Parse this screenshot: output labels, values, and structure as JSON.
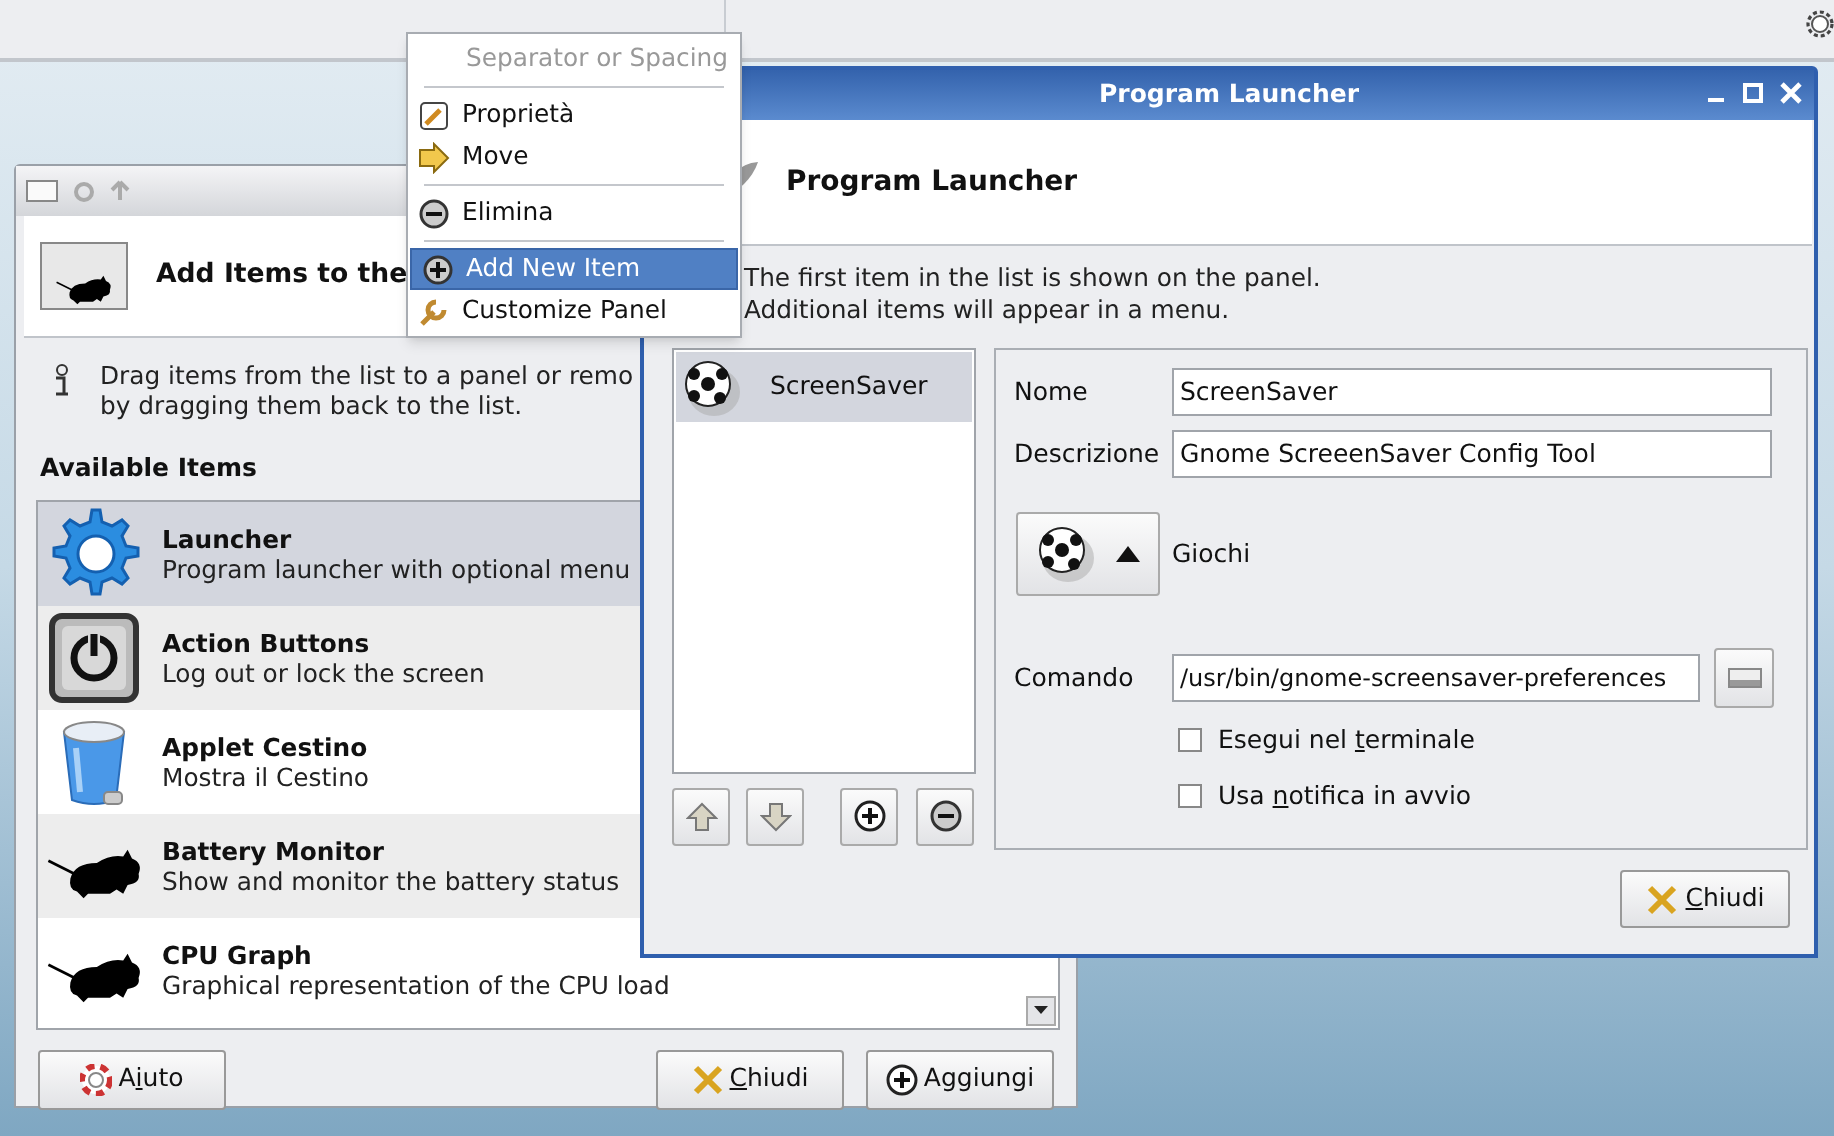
{
  "add_items_window": {
    "header": "Add Items to the",
    "info": [
      "Drag items from the list to a panel or remo",
      "by dragging them back to the list."
    ],
    "section_label": "Available Items",
    "items": [
      {
        "kind": "gear",
        "title": "Launcher",
        "description": "Program launcher with optional menu",
        "selected": true
      },
      {
        "kind": "power",
        "title": "Action Buttons",
        "description": "Log out or lock the screen",
        "selected": false
      },
      {
        "kind": "trash",
        "title": "Applet Cestino",
        "description": "Mostra il Cestino",
        "selected": false
      },
      {
        "kind": "mouse",
        "title": "Battery Monitor",
        "description": "Show and monitor the battery status",
        "selected": false
      },
      {
        "kind": "mouse",
        "title": "CPU Graph",
        "description": "Graphical representation of the CPU load",
        "selected": false
      }
    ],
    "buttons": [
      {
        "kind": "help",
        "before": "A",
        "key": "i",
        "after": "uto"
      },
      {
        "kind": "close",
        "key": "C",
        "after": "hiudi"
      },
      {
        "kind": "add",
        "before": "Aggiungi"
      }
    ]
  },
  "launcher_window": {
    "title": "Program Launcher",
    "header": "Program Launcher",
    "notes": [
      "The first item in the list is shown on the panel.",
      "Additional items will appear in a menu."
    ],
    "entries": [
      {
        "label": "ScreenSaver",
        "selected": true
      }
    ],
    "fields": [
      {
        "label": "Nome",
        "value": "ScreenSaver"
      },
      {
        "label": "Descrizione",
        "value": "Gnome ScreeenSaver Config Tool"
      }
    ],
    "category": "Giochi",
    "command": {
      "label": "Comando",
      "value": "/usr/bin/gnome-screensaver-preferences"
    },
    "options": [
      {
        "before": "Esegui nel ",
        "key": "t",
        "after": "erminale",
        "checked": false
      },
      {
        "before": "Usa ",
        "key": "n",
        "after": "otifica in avvio",
        "checked": false
      }
    ],
    "close_button": {
      "key": "C",
      "after": "hiudi"
    }
  },
  "context_menu": {
    "items": [
      {
        "kind": "title",
        "label": "Separator or Spacing",
        "disabled": true,
        "selected": false
      },
      {
        "kind": "separator"
      },
      {
        "kind": "pencil",
        "label": "Proprietà",
        "disabled": false,
        "selected": false
      },
      {
        "kind": "arrow",
        "label": "Move",
        "disabled": false,
        "selected": false
      },
      {
        "kind": "separator"
      },
      {
        "kind": "minus",
        "label": "Elimina",
        "disabled": false,
        "selected": false
      },
      {
        "kind": "separator"
      },
      {
        "kind": "plus",
        "label": "Add New Item",
        "disabled": false,
        "selected": true
      },
      {
        "kind": "wrench",
        "label": "Customize Panel",
        "disabled": false,
        "selected": false
      }
    ]
  }
}
